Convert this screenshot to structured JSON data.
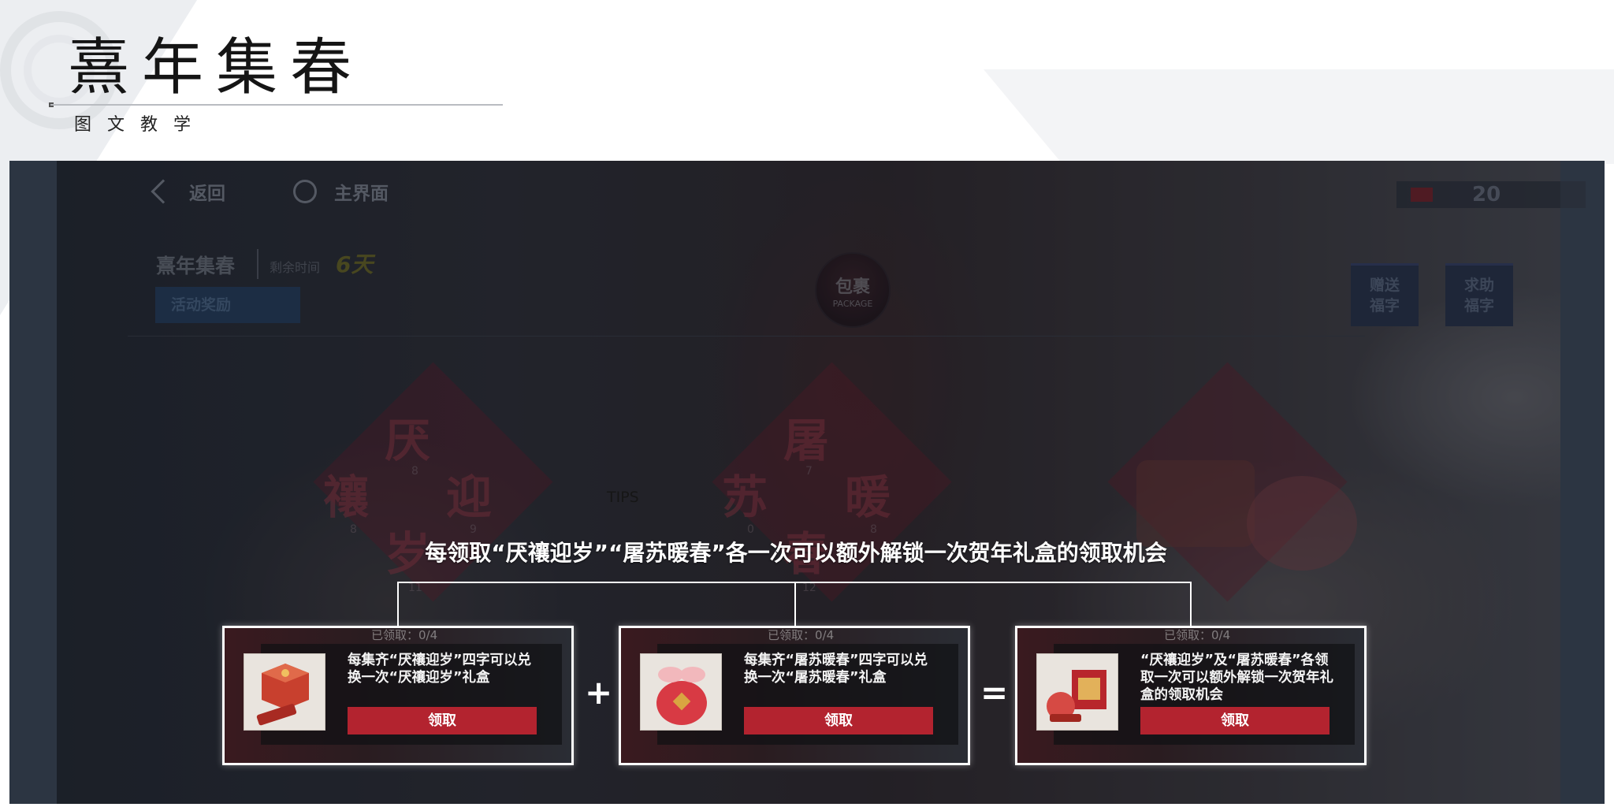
{
  "header": {
    "title": "熹年集春",
    "subtitle": "图文教学"
  },
  "game": {
    "nav": {
      "back_label": "返回",
      "home_label": "主界面"
    },
    "currency_value": "20",
    "event": {
      "title": "熹年集春",
      "remaining_label": "剩余时间",
      "remaining_value": "6天",
      "tab_label": "活动奖励"
    },
    "package": {
      "zh": "包裹",
      "en": "PACKAGE"
    },
    "side_buttons": [
      {
        "line1": "赠送",
        "line2": "福字"
      },
      {
        "line1": "求助",
        "line2": "福字"
      }
    ],
    "diamonds": [
      {
        "chars": [
          "厌",
          "禳",
          "迎",
          "岁"
        ],
        "numbers": [
          "8",
          "8",
          "9",
          "11"
        ]
      },
      {
        "chars": [
          "屠",
          "苏",
          "暖",
          "春"
        ],
        "numbers": [
          "7",
          "0",
          "8",
          "12"
        ]
      }
    ],
    "progress_ghost": "已领取：0/4"
  },
  "tips": {
    "label": "TIPS",
    "headline": "每领取“厌禳迎岁”“屠苏暖春”各一次可以额外解锁一次贺年礼盒的领取机会",
    "plus": "+",
    "equals": "=",
    "cards": [
      {
        "text": "每集齐“厌禳迎岁”四字可以兑换一次“厌禳迎岁”礼盒",
        "button": "领取"
      },
      {
        "text": "每集齐“屠苏暖春”四字可以兑换一次“屠苏暖春”礼盒",
        "button": "领取"
      },
      {
        "text": "“厌禳迎岁”及“屠苏暖春”各领取一次可以额外解锁一次贺年礼盒的领取机会",
        "button": "领取"
      }
    ]
  },
  "colors": {
    "accent_red": "#b3232f",
    "backdrop": "#2c3542"
  }
}
